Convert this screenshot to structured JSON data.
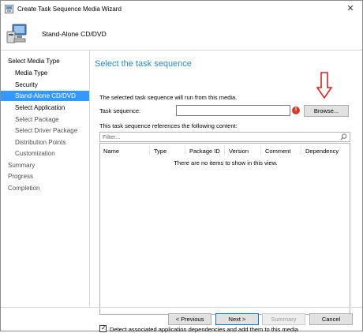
{
  "window": {
    "title": "Create Task Sequence Media Wizard"
  },
  "header": {
    "title": "Stand-Alone CD/DVD"
  },
  "sidebar": {
    "items": [
      {
        "label": "Select Media Type",
        "level": "top",
        "state": "done"
      },
      {
        "label": "Media Type",
        "level": "sub",
        "state": "done"
      },
      {
        "label": "Security",
        "level": "sub",
        "state": "done"
      },
      {
        "label": "Stand-Alone CD/DVD",
        "level": "sub",
        "state": "active"
      },
      {
        "label": "Select Application",
        "level": "sub",
        "state": "done"
      },
      {
        "label": "Select Package",
        "level": "sub",
        "state": "pending"
      },
      {
        "label": "Select Driver Package",
        "level": "sub",
        "state": "pending"
      },
      {
        "label": "Distribution Points",
        "level": "sub",
        "state": "pending"
      },
      {
        "label": "Customization",
        "level": "sub",
        "state": "pending"
      },
      {
        "label": "Summary",
        "level": "top",
        "state": "pending"
      },
      {
        "label": "Progress",
        "level": "top",
        "state": "pending"
      },
      {
        "label": "Completion",
        "level": "top",
        "state": "pending"
      }
    ]
  },
  "main": {
    "heading": "Select the task sequence",
    "description": "The selected task sequence will run from this media.",
    "task_sequence_label": "Task sequence:",
    "task_sequence_value": "",
    "error_icon": "!",
    "browse_label": "Browse...",
    "references_label": "This task sequence references the following content:",
    "filter_placeholder": "Filter...",
    "table": {
      "columns": [
        "Name",
        "Type",
        "Package ID",
        "Version",
        "Comment",
        "Dependency"
      ],
      "empty_message": "There are no items to show in this view."
    },
    "checkbox_checked": true,
    "checkbox_label": "Detect associated application dependencies and add them to this media"
  },
  "footer": {
    "back_label": "< Previous",
    "next_label": "Next >",
    "summary_label": "Summary",
    "cancel_label": "Cancel"
  },
  "colors": {
    "accent": "#3399ff",
    "heading": "#2e8bc0",
    "annotation_arrow": "#e02020",
    "error": "#d03c2c"
  }
}
